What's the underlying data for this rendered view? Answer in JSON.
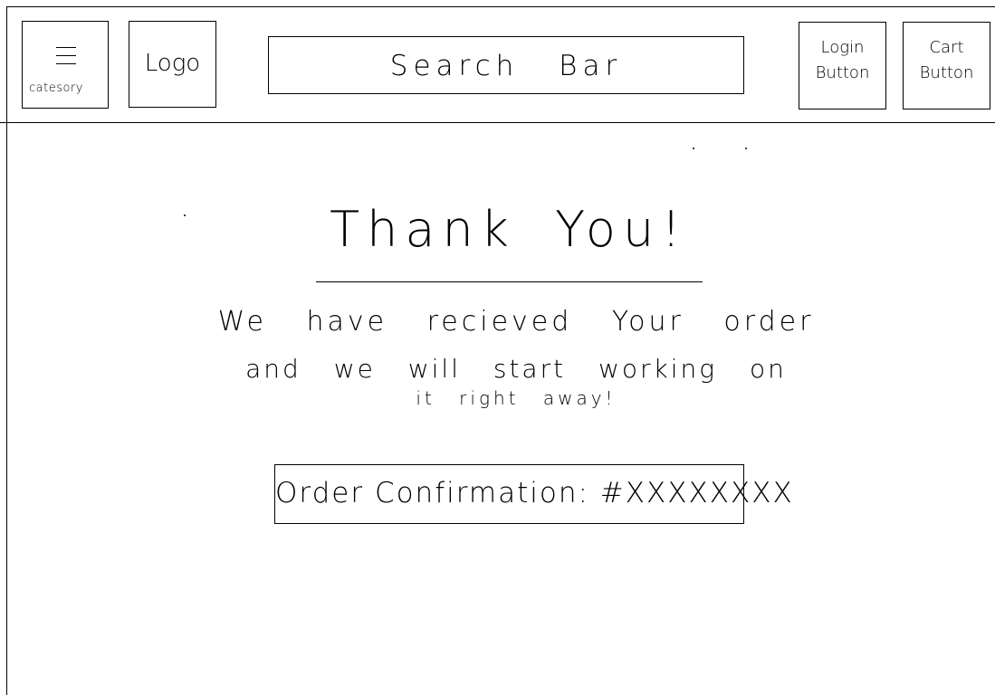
{
  "header": {
    "category_label": "catesory",
    "logo_text": "Logo",
    "search_text": "Search Bar",
    "login_label": "Login\nButton",
    "cart_label": "Cart\nButton"
  },
  "main": {
    "heading": "Thank You!",
    "message_lines": [
      "We have recieved Your order",
      "and we will start working on",
      "it right away!"
    ],
    "order_confirmation": "Order Confirmation: #XXXXXXXX"
  }
}
